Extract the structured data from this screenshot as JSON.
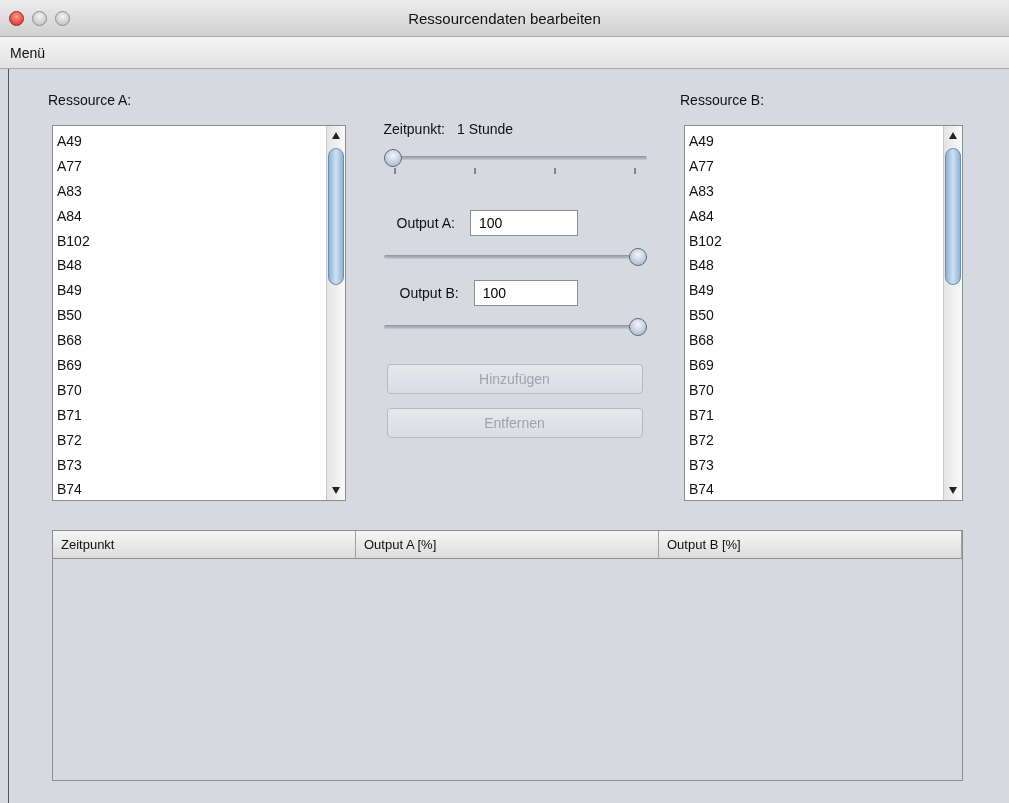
{
  "window": {
    "title": "Ressourcendaten bearbeiten"
  },
  "menu": [
    "Menü"
  ],
  "resource_a": {
    "label": "Ressource A:",
    "items": [
      "A49",
      "A77",
      "A83",
      "A84",
      "B102",
      "B48",
      "B49",
      "B50",
      "B68",
      "B69",
      "B70",
      "B71",
      "B72",
      "B73",
      "B74"
    ]
  },
  "time": {
    "label": "Zeitpunkt:",
    "value": "1 Stunde",
    "level": 0
  },
  "outputs": [
    {
      "label": "Output A:",
      "value": "100",
      "level": 1
    },
    {
      "label": "Output B:",
      "value": "100",
      "level": 1
    }
  ],
  "buttons": [
    {
      "label": "Hinzufügen",
      "disabled": true
    },
    {
      "label": "Entfernen",
      "disabled": true
    }
  ],
  "resource_b": {
    "label": "Ressource B:",
    "items": [
      "A49",
      "A77",
      "A83",
      "A84",
      "B102",
      "B48",
      "B49",
      "B50",
      "B68",
      "B69",
      "B70",
      "B71",
      "B72",
      "B73",
      "B74"
    ]
  },
  "table": {
    "columns": [
      "Zeitpunkt",
      "Output A [%]",
      "Output B [%]"
    ]
  }
}
